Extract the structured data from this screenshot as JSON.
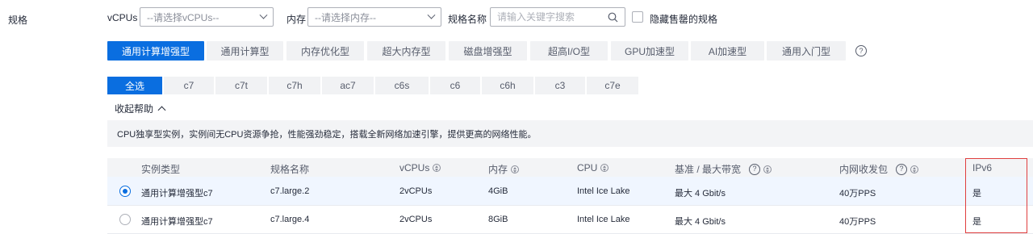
{
  "section_label": "规格",
  "filters": {
    "vcpus_label": "vCPUs",
    "vcpus_placeholder": "--请选择vCPUs--",
    "memory_label": "内存",
    "memory_placeholder": "--请选择内存--",
    "name_label": "规格名称",
    "name_placeholder": "请输入关键字搜索",
    "hide_sold_out_label": "隐藏售罄的规格"
  },
  "categories": [
    "通用计算增强型",
    "通用计算型",
    "内存优化型",
    "超大内存型",
    "磁盘增强型",
    "超高I/O型",
    "GPU加速型",
    "AI加速型",
    "通用入门型"
  ],
  "help_glyph": "?",
  "families": [
    "全选",
    "c7",
    "c7t",
    "c7h",
    "ac7",
    "c6s",
    "c6",
    "c6h",
    "c3",
    "c7e"
  ],
  "collapse_label": "收起帮助",
  "description": "CPU独享型实例，实例间无CPU资源争抢，性能强劲稳定，搭载全新网络加速引擎，提供更高的网络性能。",
  "table": {
    "headers": {
      "type": "实例类型",
      "name": "规格名称",
      "vcpus": "vCPUs",
      "memory": "内存",
      "cpu": "CPU",
      "bandwidth": "基准 / 最大带宽",
      "pps": "内网收发包",
      "ipv6": "IPv6"
    },
    "rows": [
      {
        "type": "通用计算增强型c7",
        "name": "c7.large.2",
        "vcpus": "2vCPUs",
        "memory": "4GiB",
        "cpu": "Intel Ice Lake",
        "bandwidth": "最大 4 Gbit/s",
        "pps": "40万PPS",
        "ipv6": "是",
        "selected": true
      },
      {
        "type": "通用计算增强型c7",
        "name": "c7.large.4",
        "vcpus": "2vCPUs",
        "memory": "8GiB",
        "cpu": "Intel Ice Lake",
        "bandwidth": "最大 4 Gbit/s",
        "pps": "40万PPS",
        "ipv6": "是",
        "selected": false
      }
    ]
  },
  "colors": {
    "accent": "#0a6ee0",
    "highlight_box": "#e03e3e"
  }
}
